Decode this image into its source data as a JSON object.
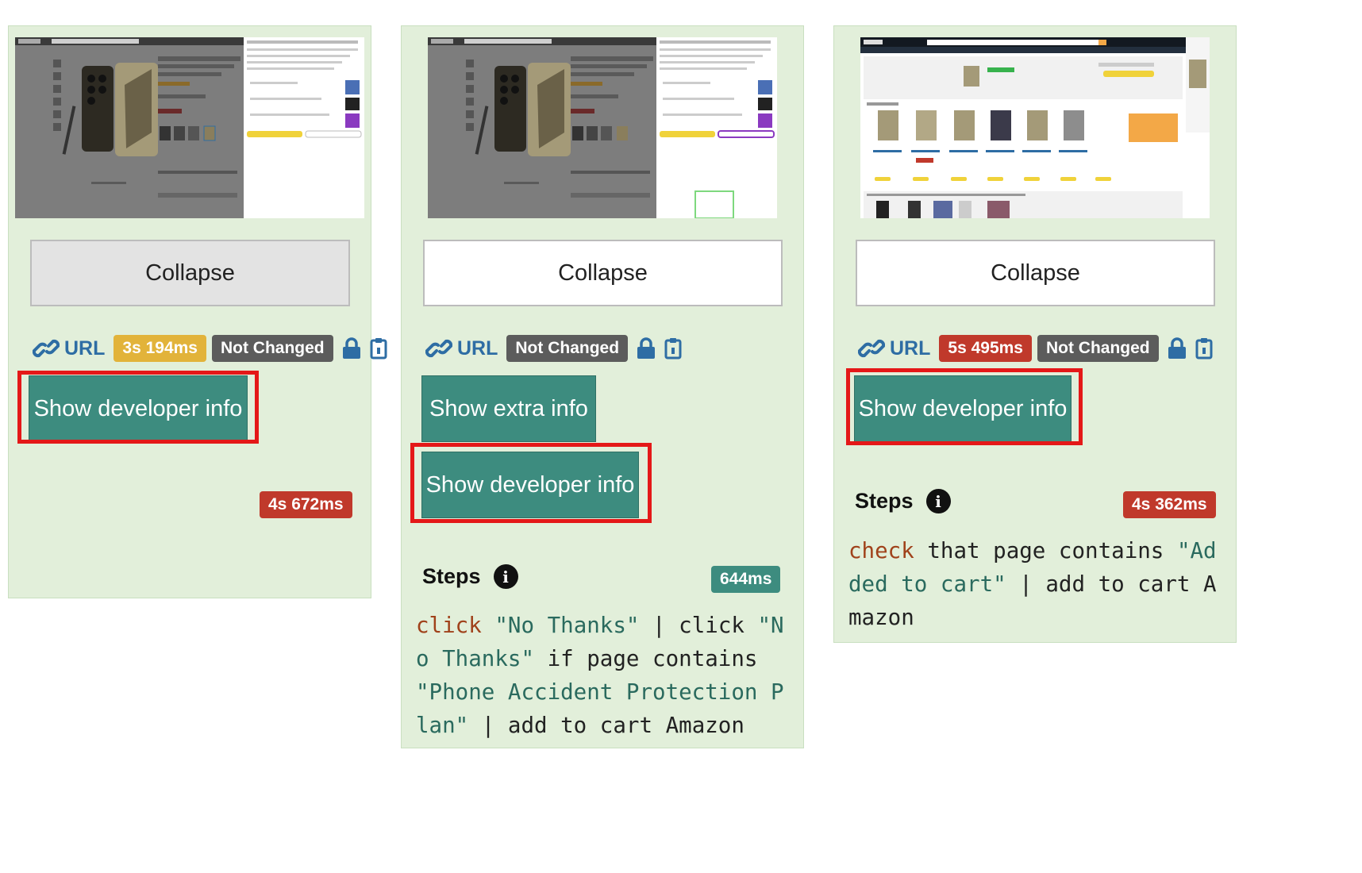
{
  "cards": [
    {
      "collapse_label": "Collapse",
      "url_label": "URL",
      "time_badge": "3s 194ms",
      "status_badge": "Not Changed",
      "developer_button": "Show developer info",
      "total_time": "4s 672ms"
    },
    {
      "collapse_label": "Collapse",
      "url_label": "URL",
      "status_badge": "Not Changed",
      "extra_button": "Show extra info",
      "developer_button": "Show developer info",
      "steps_title": "Steps",
      "steps_time": "644ms",
      "code": [
        {
          "t": "click",
          "c": "kw"
        },
        {
          "t": " ",
          "c": ""
        },
        {
          "t": "\"No Thanks\"",
          "c": "str"
        },
        {
          "t": " | click ",
          "c": ""
        },
        {
          "t": "\"No Thanks\"",
          "c": "str"
        },
        {
          "t": " if page contains ",
          "c": ""
        },
        {
          "t": "\"Phone Accident Protection Plan\"",
          "c": "str"
        },
        {
          "t": " | add to cart Amazon",
          "c": ""
        }
      ]
    },
    {
      "collapse_label": "Collapse",
      "url_label": "URL",
      "time_badge": "5s 495ms",
      "status_badge": "Not Changed",
      "developer_button": "Show developer info",
      "steps_title": "Steps",
      "steps_time": "4s 362ms",
      "code": [
        {
          "t": "check",
          "c": "kw"
        },
        {
          "t": " that page contains ",
          "c": ""
        },
        {
          "t": "\"Added to cart\"",
          "c": "str"
        },
        {
          "t": " | add to cart Amazon",
          "c": ""
        }
      ]
    }
  ],
  "icons": {
    "link": "link-icon",
    "lock": "lock-icon",
    "clipboard": "clipboard-icon",
    "info": "info-icon"
  },
  "colors": {
    "card_bg": "#e2efda",
    "teal": "#3d8c7f",
    "highlight": "#e41818",
    "badge_yellow": "#e2b33a",
    "badge_red": "#c0392b",
    "badge_dark": "#5c5c5c",
    "link": "#2e6da4"
  }
}
